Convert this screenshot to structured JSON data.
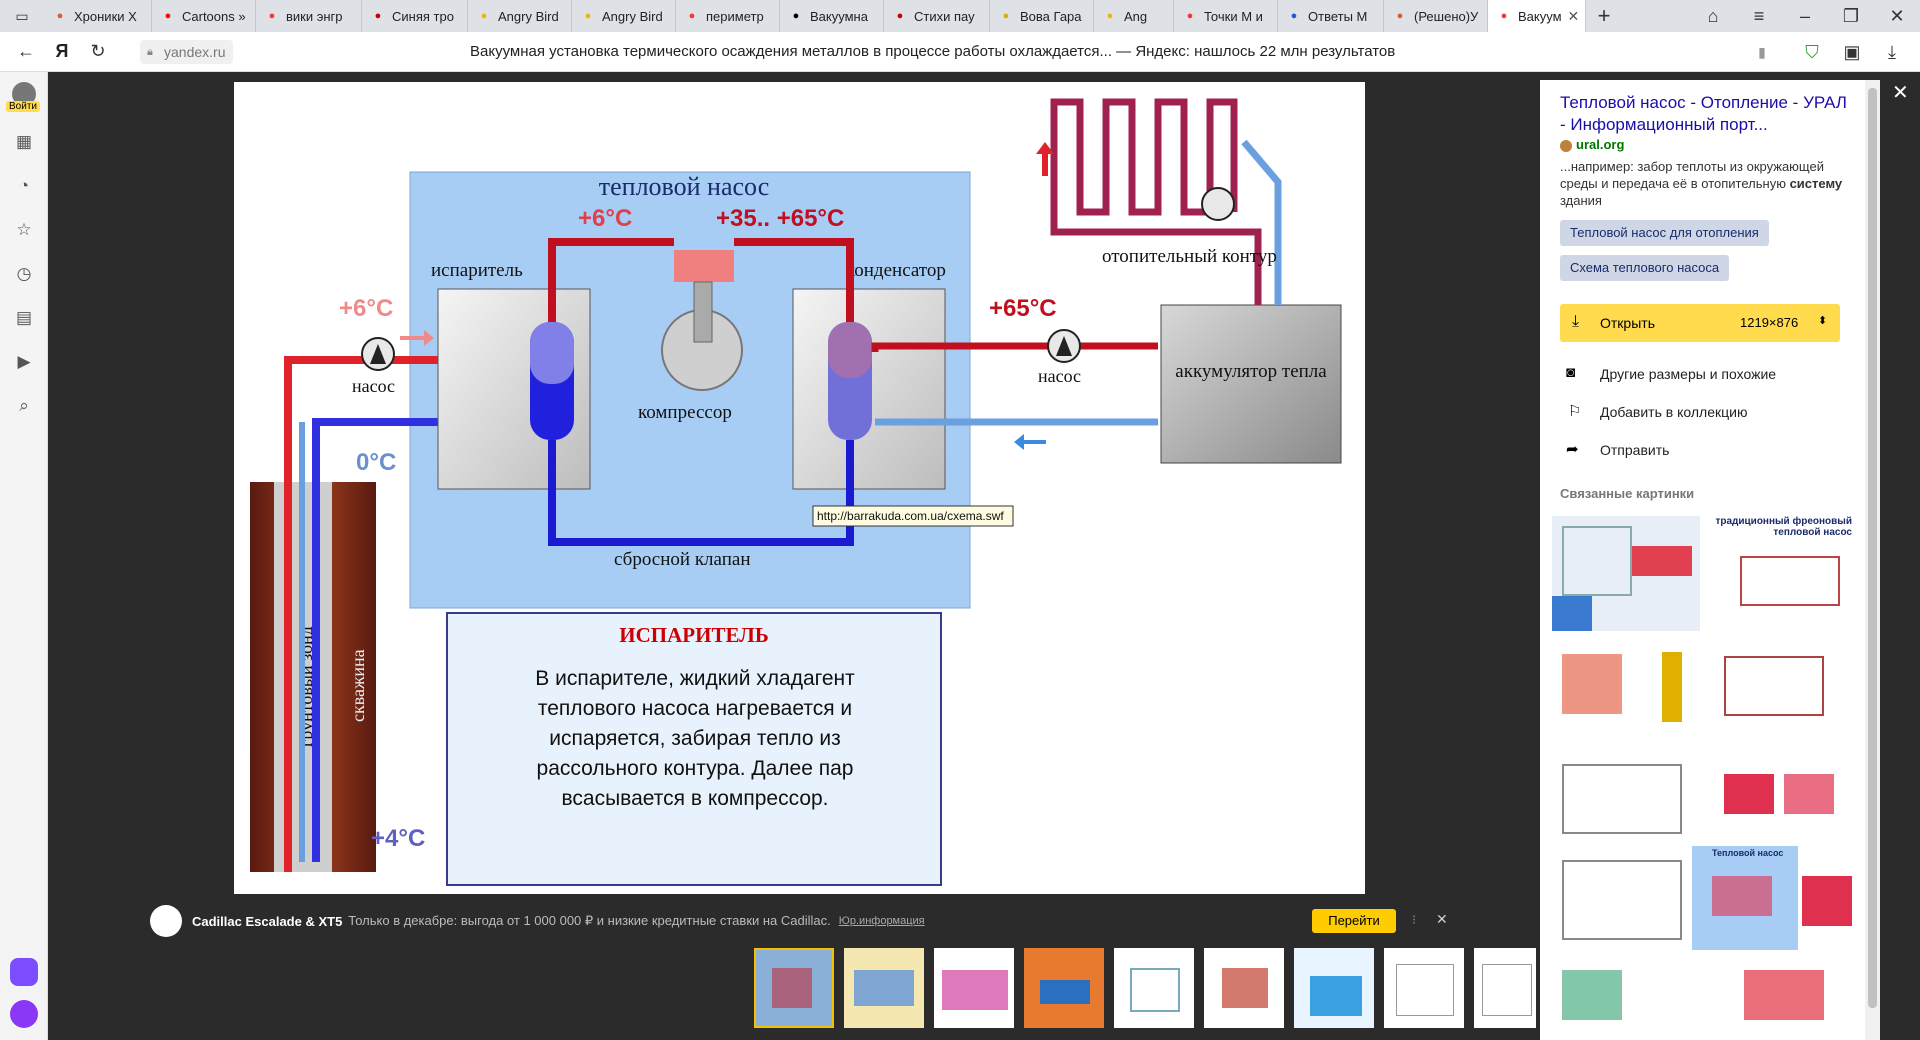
{
  "tabs": [
    {
      "label": "Хроники Х",
      "icon": "flame-icon",
      "color": "#e05a2a"
    },
    {
      "label": "Cartoons »",
      "icon": "youtube-icon",
      "color": "#ff0000"
    },
    {
      "label": "вики энгр",
      "icon": "yandex-icon",
      "color": "#ff3333"
    },
    {
      "label": "Синяя тро",
      "icon": "bird-icon",
      "color": "#c00"
    },
    {
      "label": "Angry Bird",
      "icon": "play-icon",
      "color": "#f4b400"
    },
    {
      "label": "Angry Bird",
      "icon": "play-icon",
      "color": "#f4b400"
    },
    {
      "label": "периметр",
      "icon": "yandex-icon",
      "color": "#ff3333"
    },
    {
      "label": "Вакуумна",
      "icon": "stack-icon",
      "color": "#000"
    },
    {
      "label": "Стихи пау",
      "icon": "gear-icon",
      "color": "#c00"
    },
    {
      "label": "Вова Гара",
      "icon": "sh-icon",
      "color": "#e0b000"
    },
    {
      "label": "Ang",
      "icon": "play-icon",
      "color": "#f4b400"
    },
    {
      "label": "Точки М и",
      "icon": "yandex-icon",
      "color": "#ff3333"
    },
    {
      "label": "Ответы M",
      "icon": "at-icon",
      "color": "#1e5bd0"
    },
    {
      "label": "(Решено)У",
      "icon": "five-icon",
      "color": "#e05a2a"
    },
    {
      "label": "Вакуум",
      "icon": "yandex-icon",
      "color": "#ff3333"
    }
  ],
  "address": {
    "domain": "yandex.ru",
    "title": "Вакуумная установка термического осаждения металлов в процессе работы охлаждается... — Яндекс: нашлось 22 млн результатов"
  },
  "left_bar": {
    "login_label": "Войти"
  },
  "diagram": {
    "title": "тепловой насос",
    "evaporator": "испаритель",
    "condenser": "конденсатор",
    "compressor": "компрессор",
    "relief_valve": "сбросной клапан",
    "pump1": "насос",
    "pump2": "насос",
    "heating_circuit": "отопительный контур",
    "accumulator": "аккумулятор тепла",
    "ground_probe": "грунтовый зонд",
    "borehole": "скважина",
    "t_evap_top": "+6°C",
    "t_cond_top": "+35.. +65°C",
    "t_left": "+6°C",
    "t_right": "+65°C",
    "t_zero": "0°C",
    "t_four": "+4°C",
    "tooltip": "http://barrakuda.com.ua/cxema.swf",
    "info_title": "ИСПАРИТЕЛЬ",
    "info_text": "В испарителе, жидкий хладагент теплового насоса нагревается и испаряется, забирая тепло из рассольного контура.  Далее пар всасывается в компрессор."
  },
  "ad": {
    "brand": "Cadillac Escalade & XT5",
    "text": "Только в декабре: выгода от 1 000 000 ₽ и низкие кредитные ставки на Cadillac.",
    "legal": "Юр.информация",
    "button": "Перейти"
  },
  "side": {
    "title": "Тепловой насос - Отопление - УРАЛ - Информационный порт...",
    "site": "ural.org",
    "snippet_pre": "...например: забор теплоты из окружающей среды и передача её в отопительную ",
    "snippet_bold": "систему",
    "snippet_post": " здания",
    "tags": [
      "Тепловой насос для отопления",
      "Схема теплового насоса"
    ],
    "open_label": "Открыть",
    "size": "1219×876",
    "actions": [
      "Другие размеры и похожие",
      "Добавить в коллекцию",
      "Отправить"
    ],
    "related_title": "Связанные картинки",
    "related_caption": "традиционный фреоновый тепловой насос",
    "related_caption2": "Тепловой насос"
  },
  "colors": {
    "accent": "#ffdb4d",
    "link": "#1a0dab",
    "ad_button": "#ffcc00"
  }
}
